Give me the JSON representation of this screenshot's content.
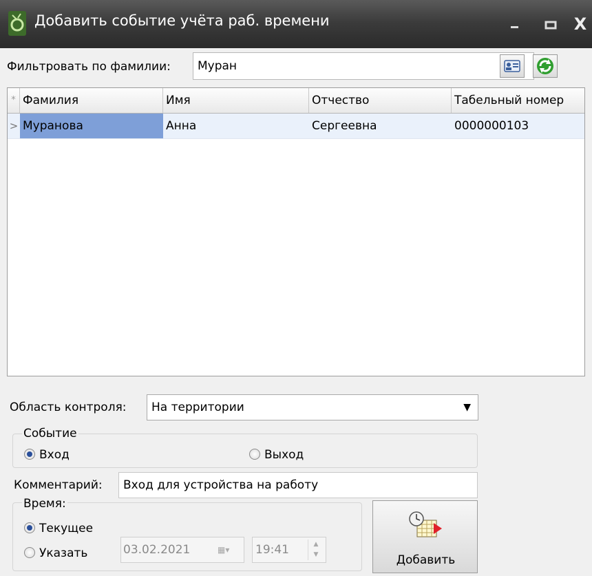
{
  "window": {
    "title": "Добавить событие учёта раб. времени",
    "close_glyph": "X"
  },
  "filter": {
    "label": "Фильтровать по фамилии:",
    "value": "Муран",
    "icons": [
      "id-card-icon",
      "refresh-icon"
    ]
  },
  "grid": {
    "new_row_marker": "*",
    "current_row_marker": ">",
    "columns": [
      "Фамилия",
      "Имя",
      "Отчество",
      "Табельный номер"
    ],
    "rows": [
      [
        "Муранова",
        "Анна",
        "Сергеевна",
        "0000000103"
      ]
    ],
    "selected_cell_color": "#7e9fd8"
  },
  "control_area": {
    "label": "Область контроля:",
    "selected": "На территории"
  },
  "event": {
    "caption": "Событие",
    "options": [
      "Вход",
      "Выход"
    ],
    "selected": "Вход"
  },
  "comment": {
    "label": "Комментарий:",
    "value": "Вход для устройства на работу"
  },
  "time": {
    "caption": "Время:",
    "options": [
      "Текущее",
      "Указать"
    ],
    "selected": "Текущее",
    "date": "03.02.2021",
    "time": "19:41"
  },
  "add_button": {
    "label": "Добавить",
    "icon": "clock-calendar-add-icon"
  },
  "colors": {
    "accent": "#2a4f9a",
    "title_bar": "#3c3c3c"
  }
}
